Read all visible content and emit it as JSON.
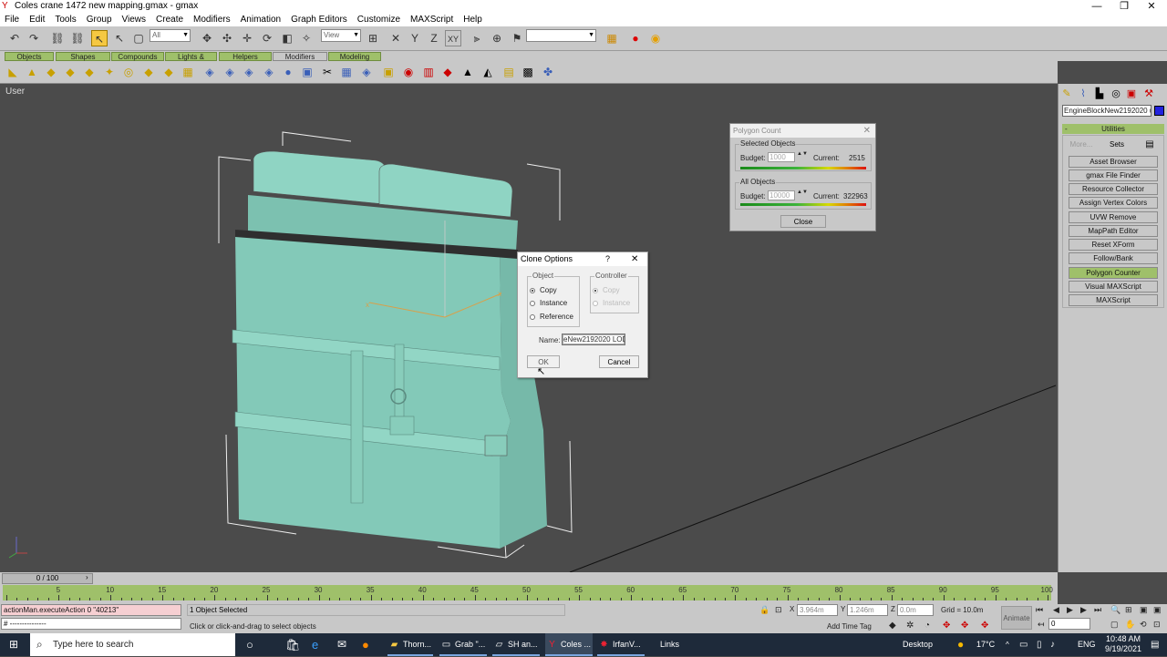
{
  "window": {
    "title": "Coles crane 1472 new mapping.gmax - gmax"
  },
  "menu": [
    "File",
    "Edit",
    "Tools",
    "Group",
    "Views",
    "Create",
    "Modifiers",
    "Animation",
    "Graph Editors",
    "Customize",
    "MAXScript",
    "Help"
  ],
  "toolbar": {
    "selection_filter": "All",
    "ref_coord": "View",
    "axis": "XY",
    "named_sel": ""
  },
  "tabs": [
    "Objects",
    "Shapes",
    "Compounds",
    "Lights & Cameras",
    "Helpers",
    "Modifiers",
    "Modeling"
  ],
  "viewport": {
    "label": "User"
  },
  "command_panel": {
    "object_name": "EngineBlockNew2192020 use",
    "color": "#2222dd",
    "rollout": "Utilities",
    "more": "More...",
    "sets": "Sets",
    "utilities": [
      "Asset Browser",
      "gmax File Finder",
      "Resource Collector",
      "Assign Vertex Colors",
      "UVW Remove",
      "MapPath Editor",
      "Reset XForm",
      "Follow/Bank",
      "Polygon Counter",
      "Visual MAXScript",
      "MAXScript"
    ],
    "selected_utility": "Polygon Counter"
  },
  "polygon_count": {
    "title": "Polygon Count",
    "selected_label": "Selected Objects",
    "all_label": "All Objects",
    "budget_label": "Budget:",
    "current_label": "Current:",
    "selected_budget": "1000",
    "selected_current": "2515",
    "all_budget": "10000",
    "all_current": "322963",
    "close": "Close"
  },
  "clone_options": {
    "title": "Clone Options",
    "help": "?",
    "object_group": "Object",
    "controller_group": "Controller",
    "copy": "Copy",
    "instance": "Instance",
    "reference": "Reference",
    "name_label": "Name:",
    "name_value": "eNew2192020 LOD1",
    "ok": "OK",
    "cancel": "Cancel"
  },
  "timeline": {
    "frame": "0 / 100",
    "ticks": [
      "0",
      "5",
      "10",
      "15",
      "20",
      "25",
      "30",
      "35",
      "40",
      "45",
      "50",
      "55",
      "60",
      "65",
      "70",
      "75",
      "80",
      "85",
      "90",
      "95",
      "100"
    ]
  },
  "status": {
    "maxscript_line": "actionMan.executeAction 0 \"40213\"",
    "maxscript_line2": "# ---------------",
    "selected": "1 Object Selected",
    "prompt": "Click or click-and-drag to select objects",
    "x": "3.964m",
    "y": "1.246m",
    "z": "0.0m",
    "grid": "Grid = 10.0m",
    "add_time_tag": "Add Time Tag",
    "animate": "Animate",
    "frame_field": "0"
  },
  "taskbar": {
    "search": "Type here to search",
    "apps": [
      "Thorn...",
      "Grab \"...",
      "SH an...",
      "Coles ...",
      "IrfanV..."
    ],
    "links": "Links",
    "desktop": "Desktop",
    "temp": "17°C",
    "lang": "ENG",
    "time": "10:48 AM",
    "date": "9/19/2021"
  }
}
